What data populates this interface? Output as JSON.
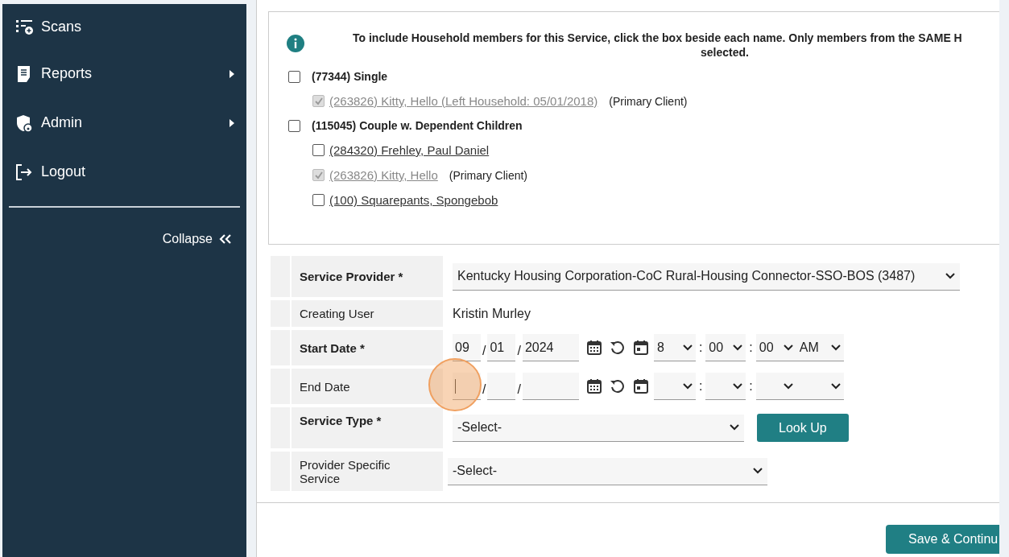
{
  "sidebar": {
    "items": [
      {
        "label": "Scans",
        "submenu": false
      },
      {
        "label": "Reports",
        "submenu": true
      },
      {
        "label": "Admin",
        "submenu": true
      },
      {
        "label": "Logout",
        "submenu": false
      }
    ],
    "collapse": "Collapse"
  },
  "household": {
    "info_lines": [
      "To include Household members for this Service, click the box beside each name. Only members from the SAME H",
      "selected."
    ],
    "groups": [
      {
        "label": "(77344) Single",
        "checked": false,
        "members": [
          {
            "label": "(263826) Kitty, Hello (Left Household: 05/01/2018)",
            "checked": true,
            "disabled": true,
            "note": "(Primary Client)"
          }
        ]
      },
      {
        "label": "(115045) Couple w. Dependent Children",
        "checked": false,
        "members": [
          {
            "label": "(284320) Frehley, Paul Daniel",
            "checked": false,
            "disabled": false
          },
          {
            "label": "(263826) Kitty, Hello",
            "checked": true,
            "disabled": true,
            "note": "(Primary Client)"
          },
          {
            "label": "(100) Squarepants, Spongebob",
            "checked": false,
            "disabled": false
          }
        ]
      }
    ]
  },
  "form": {
    "rows": [
      {
        "kind": "select",
        "label": "Service Provider *",
        "required": true,
        "value": "Kentucky Housing Corporation-CoC Rural-Housing Connector-SSO-BOS (3487)"
      },
      {
        "kind": "text",
        "label": "Creating User",
        "required": false,
        "value": "Kristin Murley"
      },
      {
        "kind": "datetime",
        "label": "Start Date *",
        "required": true,
        "month": "09",
        "day": "01",
        "year": "2024",
        "date_separators": [
          "/",
          "/"
        ],
        "hour": "8",
        "minute": "00",
        "second": "00",
        "ampm": "AM",
        "time_separators": [
          ":",
          ":"
        ],
        "month_focused": false
      },
      {
        "kind": "datetime",
        "label": "End Date",
        "required": false,
        "date_separators": [
          "/",
          "/"
        ],
        "time_separators": [
          ":",
          ":"
        ],
        "month_focused": true
      },
      {
        "kind": "lookup",
        "label": "Service Type *",
        "required": true,
        "value": "-Select-",
        "button": "Look Up"
      },
      {
        "kind": "select",
        "label": "Provider Specific Service",
        "required": false,
        "value": "-Select-"
      }
    ]
  },
  "footer": {
    "button": "Save & Continu"
  }
}
